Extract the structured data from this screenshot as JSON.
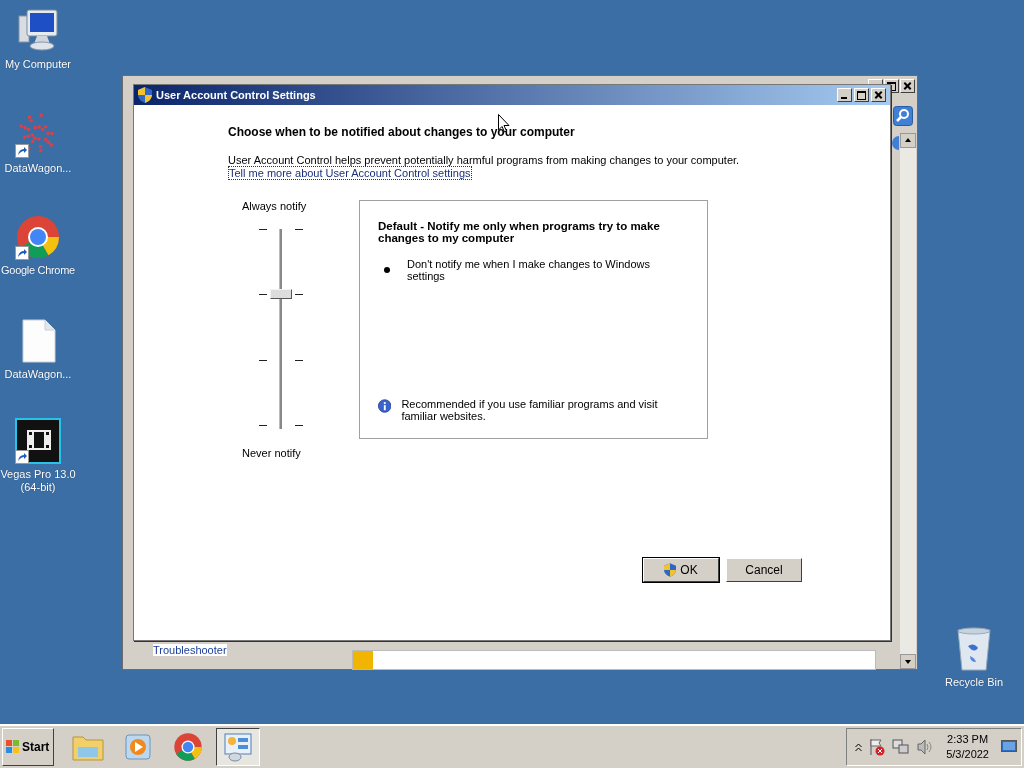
{
  "desktop_icons": [
    {
      "label": "My Computer",
      "kind": "computer",
      "shortcut": false
    },
    {
      "label": "DataWagon...",
      "kind": "dots",
      "shortcut": true
    },
    {
      "label": "Google Chrome",
      "kind": "chrome",
      "shortcut": true
    },
    {
      "label": "DataWagon...",
      "kind": "file",
      "shortcut": false
    },
    {
      "label": "Vegas Pro 13.0 (64-bit)",
      "kind": "film",
      "shortcut": true
    }
  ],
  "recycle_bin": {
    "label": "Recycle Bin"
  },
  "background_window": {
    "link": "Troubleshooter"
  },
  "dialog": {
    "title": "User Account Control Settings",
    "heading": "Choose when to be notified about changes to your computer",
    "description": "User Account Control helps prevent potentially harmful programs from making changes to your computer.",
    "link": "Tell me more about User Account Control settings",
    "slider": {
      "top_label": "Always notify",
      "bottom_label": "Never notify",
      "level": 0.67
    },
    "panel": {
      "title": "Default - Notify me only when programs try to make changes to my computer",
      "bullets": [
        "Don't notify me when I make changes to Windows settings"
      ],
      "note": "Recommended if you use familiar programs and visit familiar websites."
    },
    "buttons": [
      {
        "label": "OK",
        "kind": "shield"
      },
      {
        "label": "Cancel",
        "kind": "plain"
      }
    ]
  },
  "taskbar": {
    "start": "Start",
    "apps": [
      {
        "kind": "folder",
        "selected": false
      },
      {
        "kind": "player",
        "selected": false
      },
      {
        "kind": "chrome",
        "selected": false
      },
      {
        "kind": "control-panel",
        "selected": true
      }
    ],
    "clock": {
      "time": "2:33 PM",
      "date": "5/3/2022"
    }
  }
}
